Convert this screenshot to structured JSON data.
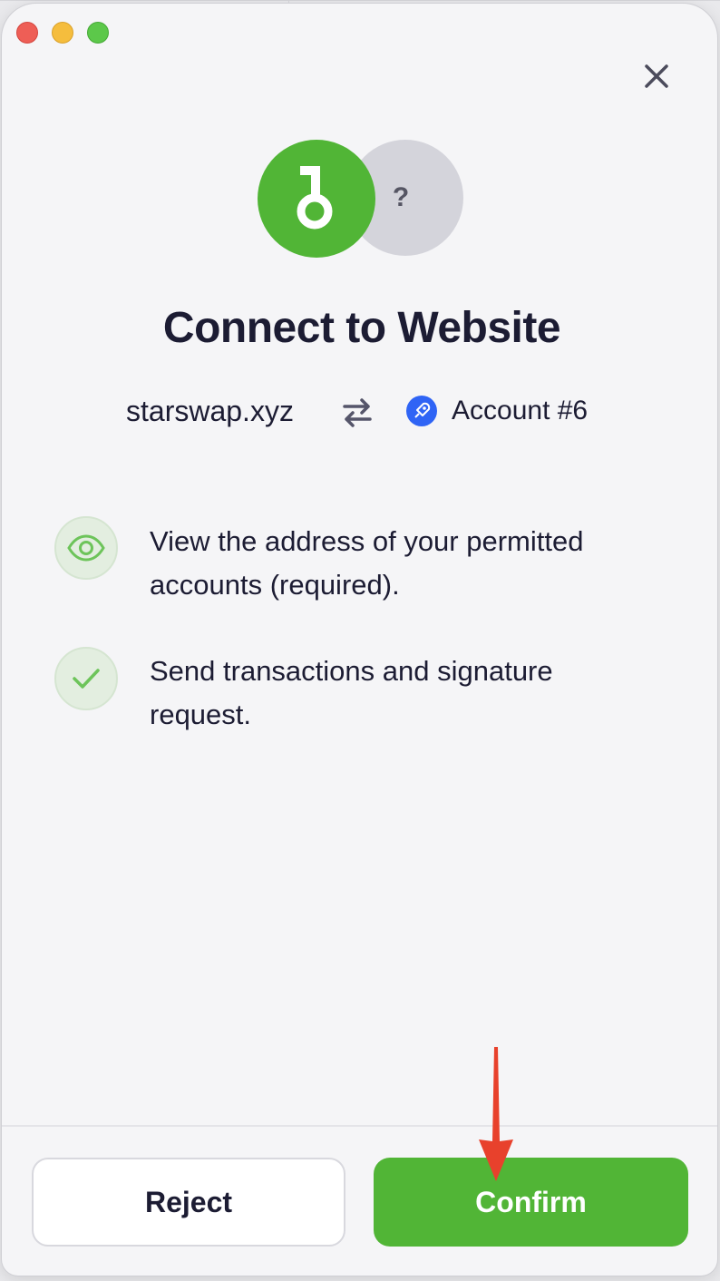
{
  "dialog": {
    "title": "Connect to Website",
    "logo_placeholder": "?",
    "site": "starswap.xyz",
    "account": "Account #6"
  },
  "permissions": [
    {
      "icon": "eye-icon",
      "text": "View the address of your permitted accounts (required)."
    },
    {
      "icon": "check-icon",
      "text": "Send transactions and signature request."
    }
  ],
  "buttons": {
    "reject_label": "Reject",
    "confirm_label": "Confirm"
  },
  "colors": {
    "accent": "#51b536",
    "account_icon": "#2f64f5",
    "annotation_arrow": "#e8412c"
  }
}
